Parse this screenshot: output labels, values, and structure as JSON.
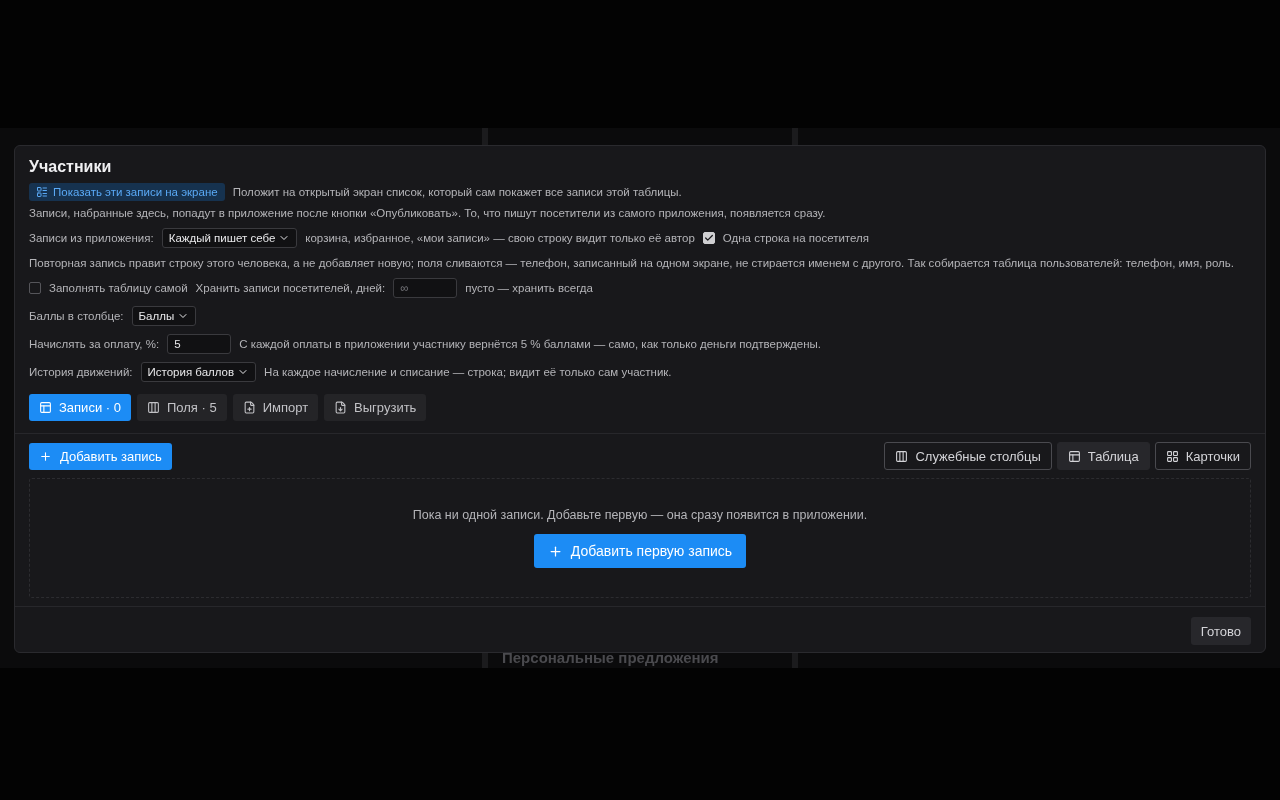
{
  "backdrop": {
    "section_title": "Персональные предложения"
  },
  "dialog": {
    "title": "Участники",
    "show_on_screen": {
      "label": "Показать эти записи на экране",
      "hint": "Положит на открытый экран список, который сам покажет все записи этой таблицы."
    },
    "publish_note": "Записи, набранные здесь, попадут в приложение после кнопки «Опубликовать». То, что пишут посетители из самого приложения, появляется сразу.",
    "app_entries": {
      "label": "Записи из приложения:",
      "value": "Каждый пишет себе",
      "hint": "корзина, избранное, «мои записи» — свою строку видит только её автор",
      "one_row": {
        "label": "Одна строка на посетителя",
        "checked": true
      }
    },
    "merge_note": "Повторная запись правит строку этого человека, а не добавляет новую; поля сливаются — телефон, записанный на одном экране, не стирается именем с другого. Так собирается таблица пользователей: телефон, имя, роль.",
    "fill_self": {
      "label": "Заполнять таблицу самой",
      "checked": false
    },
    "retention": {
      "label": "Хранить записи посетителей, дней:",
      "placeholder": "∞",
      "hint": "пусто — хранить всегда"
    },
    "points_column": {
      "label": "Баллы в столбце:",
      "value": "Баллы"
    },
    "accrual": {
      "label": "Начислять за оплату, %:",
      "value": "5",
      "hint": "С каждой оплаты в приложении участнику вернётся 5 % баллами — само, как только деньги подтверждены."
    },
    "history": {
      "label": "История движений:",
      "value": "История баллов",
      "hint": "На каждое начисление и списание — строка; видит её только сам участник."
    },
    "tabs": [
      {
        "label": "Записи · 0",
        "selected": true
      },
      {
        "label": "Поля · 5",
        "selected": false
      },
      {
        "label": "Импорт",
        "selected": false
      },
      {
        "label": "Выгрузить",
        "selected": false
      }
    ],
    "add_button": "Добавить запись",
    "view_options": [
      {
        "label": "Служебные столбцы",
        "selected": false
      },
      {
        "label": "Таблица",
        "selected": true
      },
      {
        "label": "Карточки",
        "selected": false
      }
    ],
    "empty_state": {
      "message": "Пока ни одной записи. Добавьте первую — она сразу появится в приложении.",
      "button": "Добавить первую запись"
    },
    "done_button": "Готово"
  }
}
